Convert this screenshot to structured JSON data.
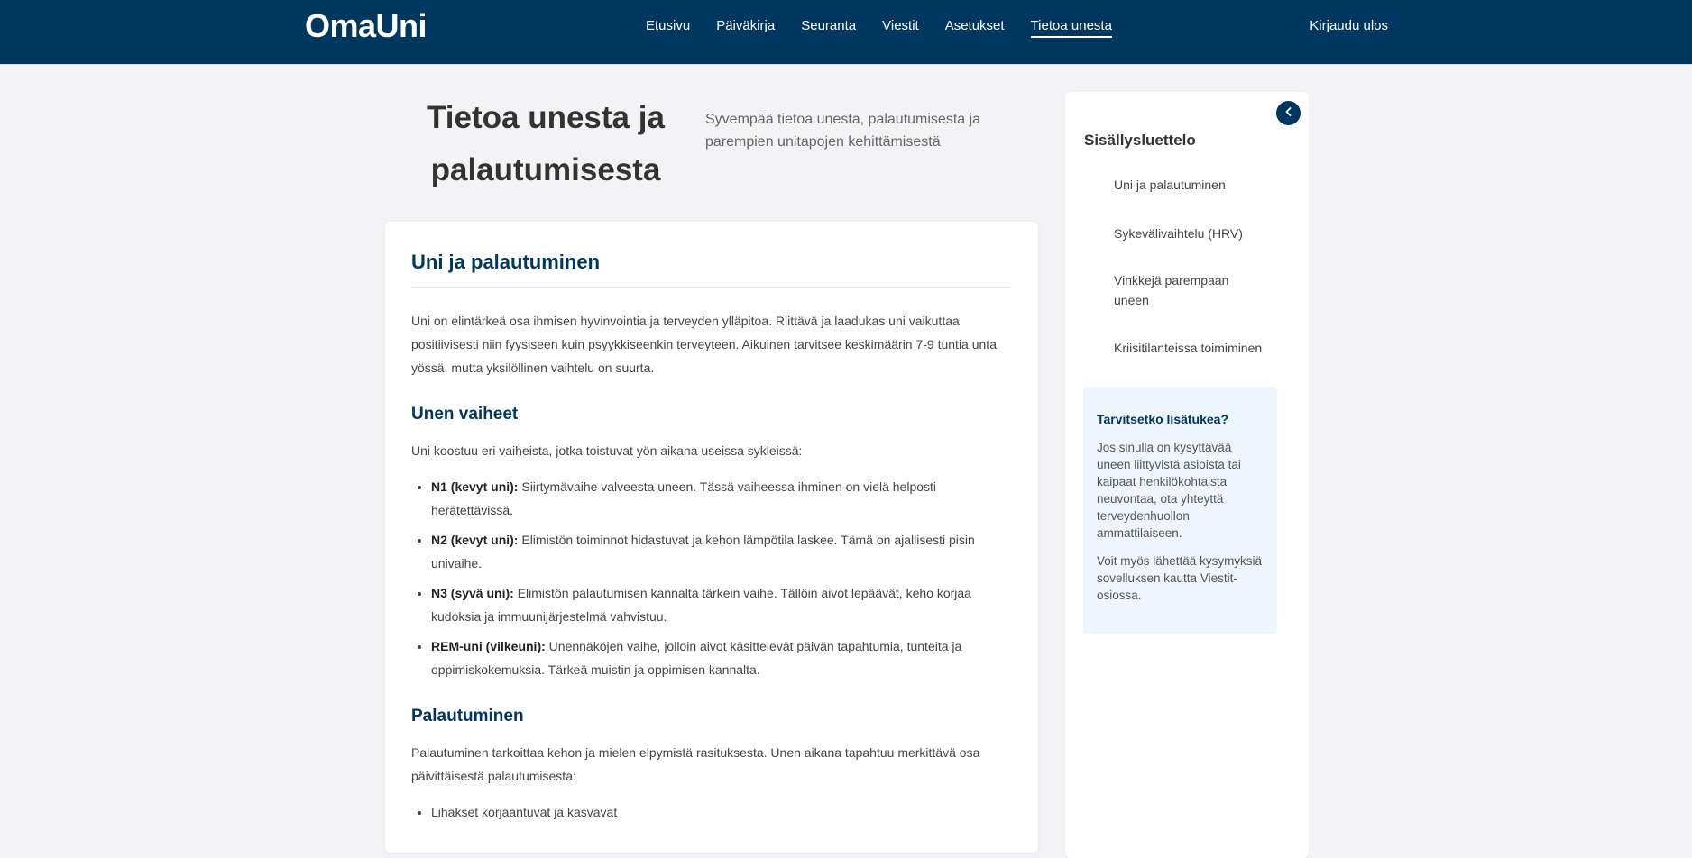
{
  "header": {
    "logo": "OmaUni",
    "nav": [
      {
        "label": "Etusivu"
      },
      {
        "label": "Päiväkirja"
      },
      {
        "label": "Seuranta"
      },
      {
        "label": "Viestit"
      },
      {
        "label": "Asetukset"
      },
      {
        "label": "Tietoa unesta",
        "active": true
      }
    ],
    "logout_label": "Kirjaudu ulos"
  },
  "page": {
    "title": "Tietoa unesta ja palautumisesta",
    "subtitle": "Syvempää tietoa unesta, palautumisesta ja parempien unitapojen kehittämisestä"
  },
  "article": {
    "heading": "Uni ja palautuminen",
    "intro": "Uni on elintärkeä osa ihmisen hyvinvointia ja terveyden ylläpitoa. Riittävä ja laadukas uni vaikuttaa positiivisesti niin fyysiseen kuin psyykkiseenkin terveyteen. Aikuinen tarvitsee keskimäärin 7-9 tuntia unta yössä, mutta yksilöllinen vaihtelu on suurta.",
    "stages_heading": "Unen vaiheet",
    "stages_intro": "Uni koostuu eri vaiheista, jotka toistuvat yön aikana useissa sykleissä:",
    "stages": [
      {
        "term": "N1 (kevyt uni):",
        "text": " Siirtymävaihe valveesta uneen. Tässä vaiheessa ihminen on vielä helposti herätettävissä."
      },
      {
        "term": "N2 (kevyt uni):",
        "text": " Elimistön toiminnot hidastuvat ja kehon lämpötila laskee. Tämä on ajallisesti pisin univaihe."
      },
      {
        "term": "N3 (syvä uni):",
        "text": " Elimistön palautumisen kannalta tärkein vaihe. Tällöin aivot lepäävät, keho korjaa kudoksia ja immuunijärjestelmä vahvistuu."
      },
      {
        "term": "REM-uni (vilkeuni):",
        "text": " Unennäköjen vaihe, jolloin aivot käsittelevät päivän tapahtumia, tunteita ja oppimiskokemuksia. Tärkeä muistin ja oppimisen kannalta."
      }
    ],
    "recovery_heading": "Palautuminen",
    "recovery_intro": "Palautuminen tarkoittaa kehon ja mielen elpymistä rasituksesta. Unen aikana tapahtuu merkittävä osa päivittäisestä palautumisesta:",
    "recovery_items": [
      {
        "text": "Lihakset korjaantuvat ja kasvavat"
      }
    ]
  },
  "sidebar": {
    "toc_title": "Sisällysluettelo",
    "toc": [
      {
        "label": "Uni ja palautuminen"
      },
      {
        "label": "Sykevälivaihtelu (HRV)"
      },
      {
        "label": "Vinkkejä parempaan uneen"
      },
      {
        "label": "Kriisitilanteissa toimiminen"
      }
    ],
    "help": {
      "title": "Tarvitsetko lisätukea?",
      "text1": "Jos sinulla on kysyttävää uneen liittyvistä asioista tai kaipaat henkilökohtaista neuvontaa, ota yhteyttä terveydenhuollon ammattilaiseen.",
      "text2": "Voit myös lähettää kysymyksiä sovelluksen kautta Viestit-osiossa."
    },
    "collapse_icon": "chevron-left-icon"
  },
  "colors": {
    "brand": "#003760",
    "background": "#f3f3f5",
    "help_box": "#eef5fd"
  }
}
